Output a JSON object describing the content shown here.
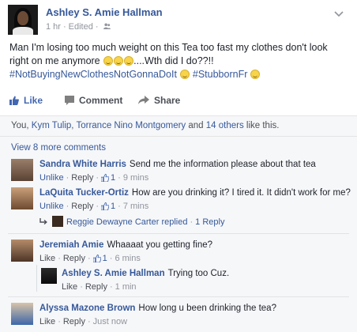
{
  "post": {
    "author": "Ashley S. Amie Hallman",
    "time": "1 hr",
    "edited": "Edited",
    "text_line1": "Man I'm losing too much weight on this Tea too fast my clothes don't look",
    "text_line2_prefix": "right on me anymore",
    "text_line2_suffix": "....Wth did I do??!!",
    "hashtag1": "#NotBuyingNewClothesNotGonnaDoIt",
    "hashtag2": "#StubbornFr"
  },
  "actions": {
    "like": "Like",
    "comment": "Comment",
    "share": "Share"
  },
  "likes": {
    "you": "You, ",
    "name1": "Kym Tulip",
    "comma": ", ",
    "name2": "Torrance Nino Montgomery",
    "and": " and ",
    "others": "14 others",
    "suffix": " like this."
  },
  "comments_section": {
    "view_more": "View 8 more comments",
    "items": [
      {
        "name": "Sandra White Harris",
        "text": "Send me the information please about that tea",
        "unlike": "Unlike",
        "reply": "Reply",
        "likes": "1",
        "time": "9 mins"
      },
      {
        "name": "LaQuita Tucker-Ortiz",
        "text": "How are you drinking it? I tired it. It didn't work for me?",
        "unlike": "Unlike",
        "reply": "Reply",
        "likes": "1",
        "time": "7 mins"
      },
      {
        "name": "Jeremiah Amie",
        "text": "Whaaaat you getting fine?",
        "like": "Like",
        "reply": "Reply",
        "likes": "1",
        "time": "6 mins"
      },
      {
        "name": "Ashley S. Amie Hallman",
        "text": "Trying too Cuz.",
        "like": "Like",
        "reply": "Reply",
        "time": "1 min"
      },
      {
        "name": "Alyssa Mazone Brown",
        "text": "How long u been drinking the tea?",
        "like": "Like",
        "reply": "Reply",
        "time": "Just now"
      }
    ],
    "reply_summary": {
      "name": "Reggie Dewayne Carter",
      "replied": "replied",
      "count": "1 Reply"
    }
  },
  "colors": {
    "link": "#365899",
    "like_blue": "#4267b2",
    "gray_text": "#90949c",
    "comment_bg": "#f6f7f9"
  },
  "icons": [
    "friends-icon",
    "chevron-down-icon",
    "like-icon",
    "comment-icon",
    "share-icon",
    "thumbs-up-icon",
    "reply-arrow-icon",
    "emoji-grin-icon",
    "emoji-sad-icon"
  ]
}
